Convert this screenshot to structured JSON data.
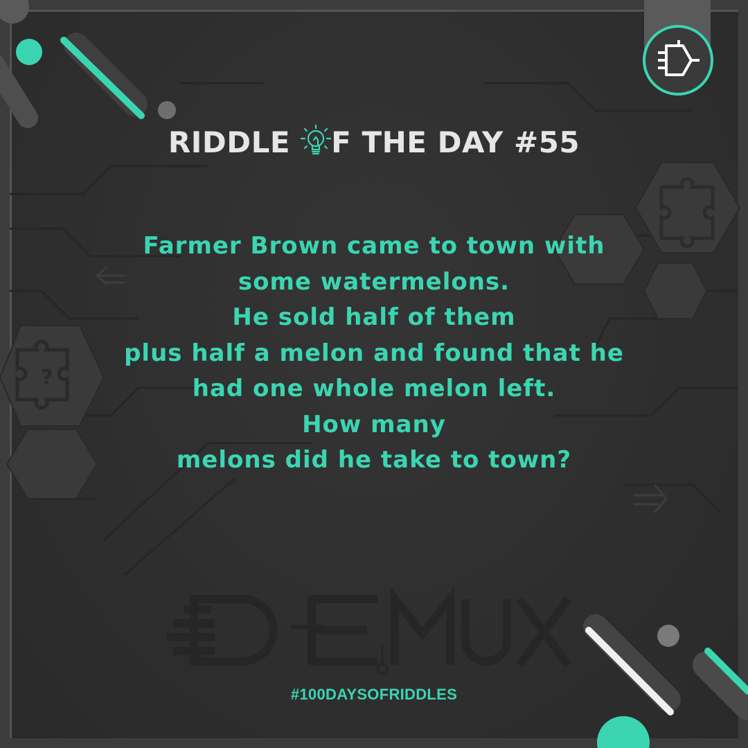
{
  "title": {
    "before_bulb": "RIDDLE ",
    "after_bulb": "F THE DAY #55"
  },
  "riddle_lines": [
    "Farmer Brown came to town with",
    "some watermelons.",
    "He sold half of them",
    "plus half a melon and found that he",
    "had one whole melon left.",
    "How many",
    "melons did he take to town?"
  ],
  "hashtag": "#100DAYSOFRIDDLES",
  "watermark_text": "DEMUX",
  "icons": [
    "lightbulb-icon",
    "demux-logo-icon",
    "puzzle-icon",
    "question-puzzle-icon",
    "arrow-left-icon",
    "arrow-right-icon"
  ],
  "colors": {
    "accent": "#3bd5b2",
    "background": "#2e2e2e",
    "title": "#e6e6e6",
    "frame": "#4a4a4a"
  }
}
